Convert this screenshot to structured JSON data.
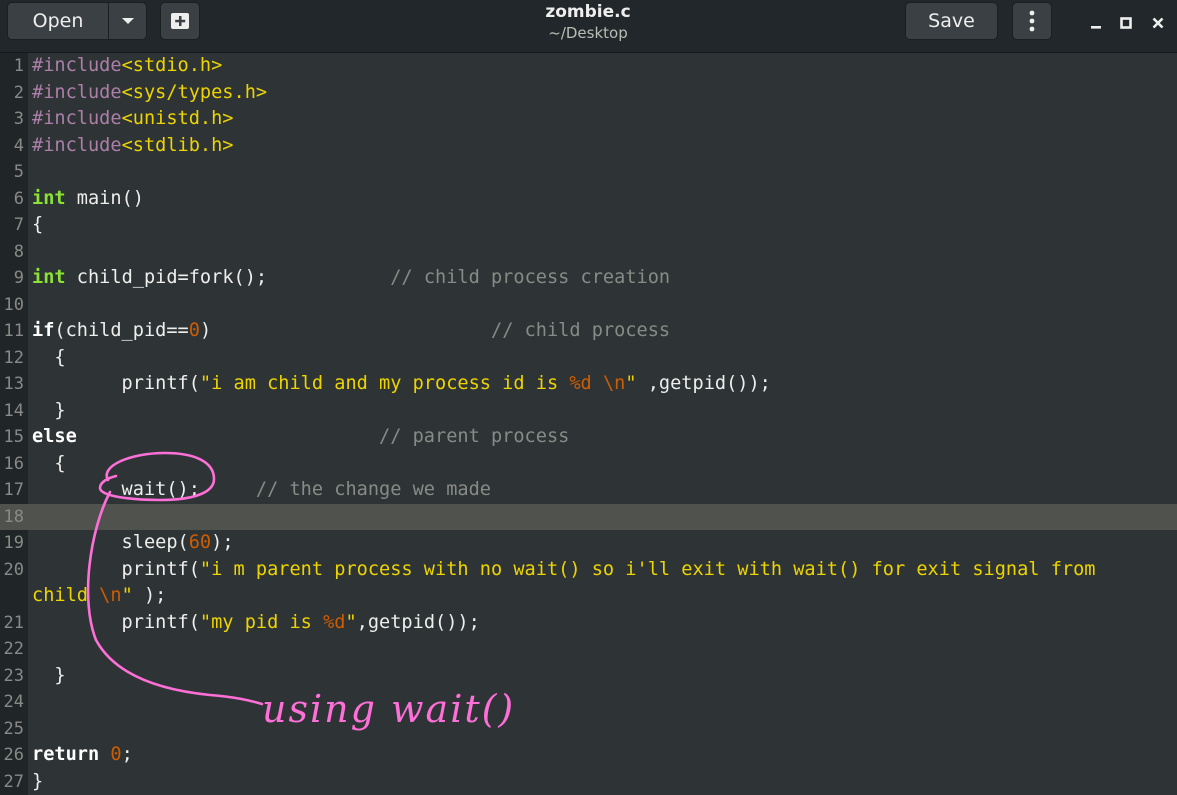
{
  "header": {
    "open_label": "Open",
    "save_label": "Save",
    "title": "zombie.c",
    "subtitle": "~/Desktop",
    "icons": {
      "dropdown": "chevron-down-icon",
      "new_tab": "new-document-icon",
      "menu": "kebab-menu-icon",
      "minimize": "minimize-icon",
      "maximize": "maximize-icon",
      "close": "close-icon"
    }
  },
  "editor": {
    "current_line": 18,
    "lines": [
      {
        "n": "1",
        "code": "#include<stdio.h>"
      },
      {
        "n": "2",
        "code": "#include<sys/types.h>"
      },
      {
        "n": "3",
        "code": "#include<unistd.h>"
      },
      {
        "n": "4",
        "code": "#include<stdlib.h>"
      },
      {
        "n": "5",
        "code": ""
      },
      {
        "n": "6",
        "code": "int main()"
      },
      {
        "n": "7",
        "code": "{"
      },
      {
        "n": "8",
        "code": ""
      },
      {
        "n": "9",
        "code": "int child_pid=fork();           // child process creation"
      },
      {
        "n": "10",
        "code": ""
      },
      {
        "n": "11",
        "code": "if(child_pid==0)                         // child process"
      },
      {
        "n": "12",
        "code": "  {"
      },
      {
        "n": "13",
        "code": "        printf(\"i am child and my process id is %d \\n\" ,getpid());"
      },
      {
        "n": "14",
        "code": "  }"
      },
      {
        "n": "15",
        "code": "else                           // parent process"
      },
      {
        "n": "16",
        "code": "  {"
      },
      {
        "n": "17",
        "code": "        wait();     // the change we made"
      },
      {
        "n": "18",
        "code": ""
      },
      {
        "n": "19",
        "code": "        sleep(60);"
      },
      {
        "n": "20",
        "code": "        printf(\"i m parent process with no wait() so i'll exit with wait() for exit signal from"
      },
      {
        "n": "",
        "code": "child \\n\" );"
      },
      {
        "n": "21",
        "code": "        printf(\"my pid is %d\",getpid());"
      },
      {
        "n": "22",
        "code": ""
      },
      {
        "n": "23",
        "code": "  }"
      },
      {
        "n": "24",
        "code": ""
      },
      {
        "n": "25",
        "code": ""
      },
      {
        "n": "26",
        "code": "return 0;"
      },
      {
        "n": "27",
        "code": "}"
      }
    ]
  },
  "annotation": {
    "handwritten_text": "using wait()",
    "color": "#ff6fd8"
  },
  "colors": {
    "background": "#2e3436",
    "titlebar": "#22272b",
    "current_line": "#50524d",
    "preprocessor": "#ad7fa8",
    "keyword": "#8ae234",
    "string": "#edd400",
    "number": "#ce5c00",
    "comment": "#888a85"
  }
}
